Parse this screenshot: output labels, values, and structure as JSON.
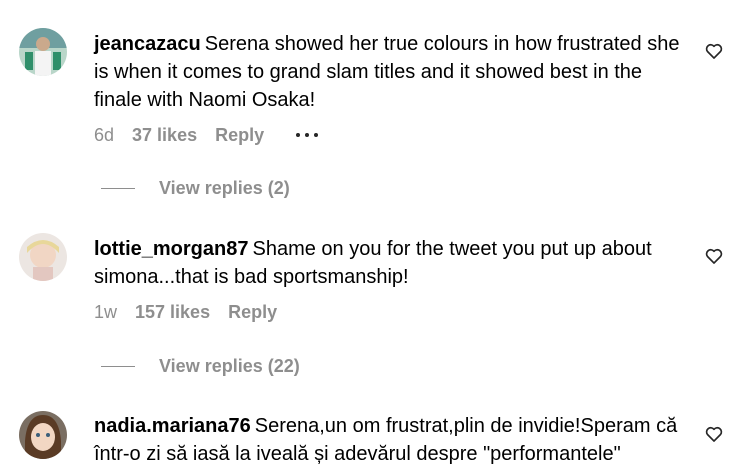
{
  "comments": [
    {
      "username": "jeancazacu",
      "text": "Serena showed her true colours in how frustrated she is when it comes to grand slam titles and it showed best in the finale with Naomi Osaka!",
      "time": "6d",
      "likes": "37 likes",
      "reply_label": "Reply",
      "view_replies": "View replies (2)"
    },
    {
      "username": "lottie_morgan87",
      "text": "Shame on you for the tweet you put up about simona...that is bad sportsmanship!",
      "time": "1w",
      "likes": "157 likes",
      "reply_label": "Reply",
      "view_replies": "View replies (22)"
    },
    {
      "username": "nadia.mariana76",
      "text": "Serena,un om frustrat,plin de invidie!Speram că într-o zi să iasă la iveală și adevărul despre \"performantele\""
    }
  ],
  "colors": {
    "secondary_text": "#8e8e8e",
    "primary_text": "#000000",
    "background": "#ffffff"
  },
  "icons": {
    "like": "heart-outline-icon",
    "more": "more-options-icon"
  }
}
